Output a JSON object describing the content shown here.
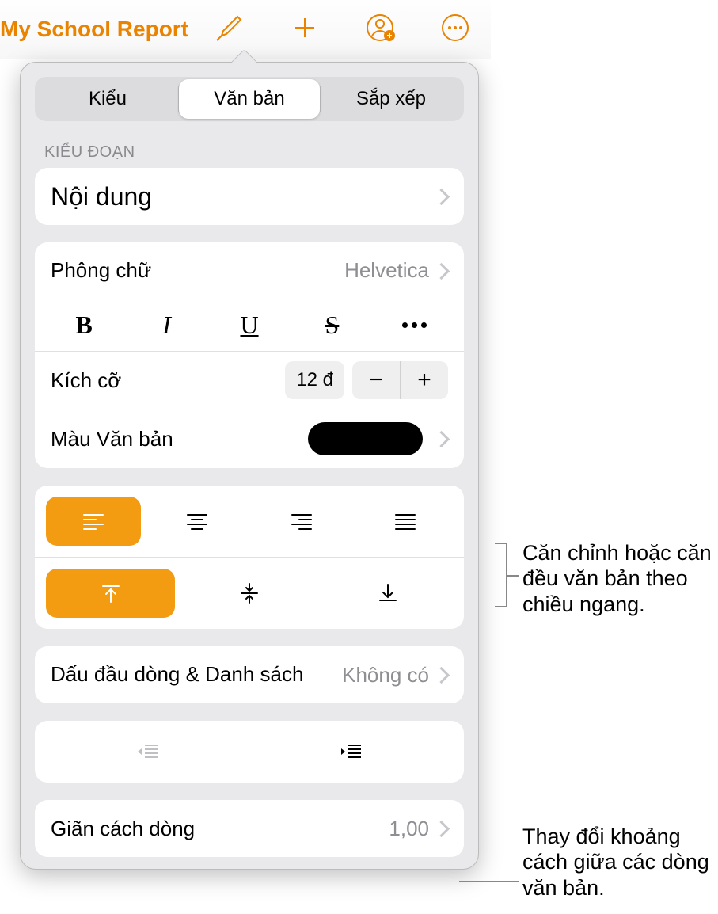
{
  "toolbar": {
    "doc_title": "My School Report"
  },
  "popover": {
    "tabs": {
      "style": "Kiểu",
      "text": "Văn bản",
      "arrange": "Sắp xếp"
    },
    "section_paragraph_style": "KIỂU ĐOẠN",
    "paragraph_style_value": "Nội dung",
    "font_label": "Phông chữ",
    "font_value": "Helvetica",
    "bold": "B",
    "italic": "I",
    "underline": "U",
    "strike": "S",
    "size_label": "Kích cỡ",
    "size_value": "12 đ",
    "stepper_minus": "−",
    "stepper_plus": "+",
    "text_color_label": "Màu Văn bản",
    "bullets_label": "Dấu đầu dòng & Danh sách",
    "bullets_value": "Không có",
    "line_spacing_label": "Giãn cách dòng",
    "line_spacing_value": "1,00"
  },
  "callouts": {
    "align": "Căn chỉnh hoặc căn đều văn bản theo chiều ngang.",
    "spacing": "Thay đổi khoảng cách giữa các dòng văn bản."
  }
}
